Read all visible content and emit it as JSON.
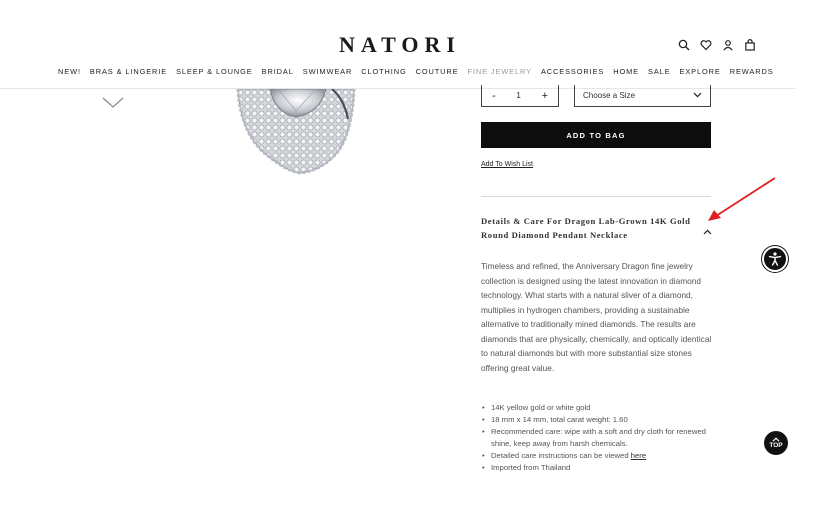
{
  "brand": {
    "logo": "NATORI"
  },
  "nav": {
    "items": [
      "NEW!",
      "BRAS & LINGERIE",
      "SLEEP & LOUNGE",
      "BRIDAL",
      "SWIMWEAR",
      "CLOTHING",
      "COUTURE",
      "FINE JEWELRY",
      "ACCESSORIES",
      "HOME",
      "SALE",
      "EXPLORE",
      "REWARDS"
    ]
  },
  "header_icons": [
    "search-icon",
    "heart-icon",
    "account-icon",
    "bag-icon"
  ],
  "purchase": {
    "qty_minus": "-",
    "qty_value": "1",
    "qty_plus": "+",
    "size_label": "Choose a Size",
    "add_to_bag": "ADD TO BAG",
    "wishlist": "Add To Wish List"
  },
  "details": {
    "title": "Details & Care For Dragon Lab-Grown 14K Gold Round Diamond Pendant Necklace",
    "description": "Timeless and refined, the Anniversary Dragon fine jewelry collection is designed using the latest innovation in diamond technology. What starts with a natural sliver of a diamond, multiplies in hydrogen chambers, providing a sustainable alternative to traditionally mined diamonds. The results are diamonds that are physically, chemically, and optically identical to natural diamonds but with more substantial size stones offering great value.",
    "specs": [
      "14K yellow gold or white gold",
      "18 mm x 14 mm, total carat weight: 1.60",
      "Recommended care: wipe with a soft and dry cloth for renewed shine, keep away from harsh chemicals.",
      "Detailed care instructions can be viewed ",
      "Imported from Thailand"
    ],
    "care_link": "here"
  },
  "floating": {
    "top_label": "TOP"
  },
  "colors": {
    "accent_black": "#0d0d0d",
    "annotation_red": "#e02020"
  }
}
